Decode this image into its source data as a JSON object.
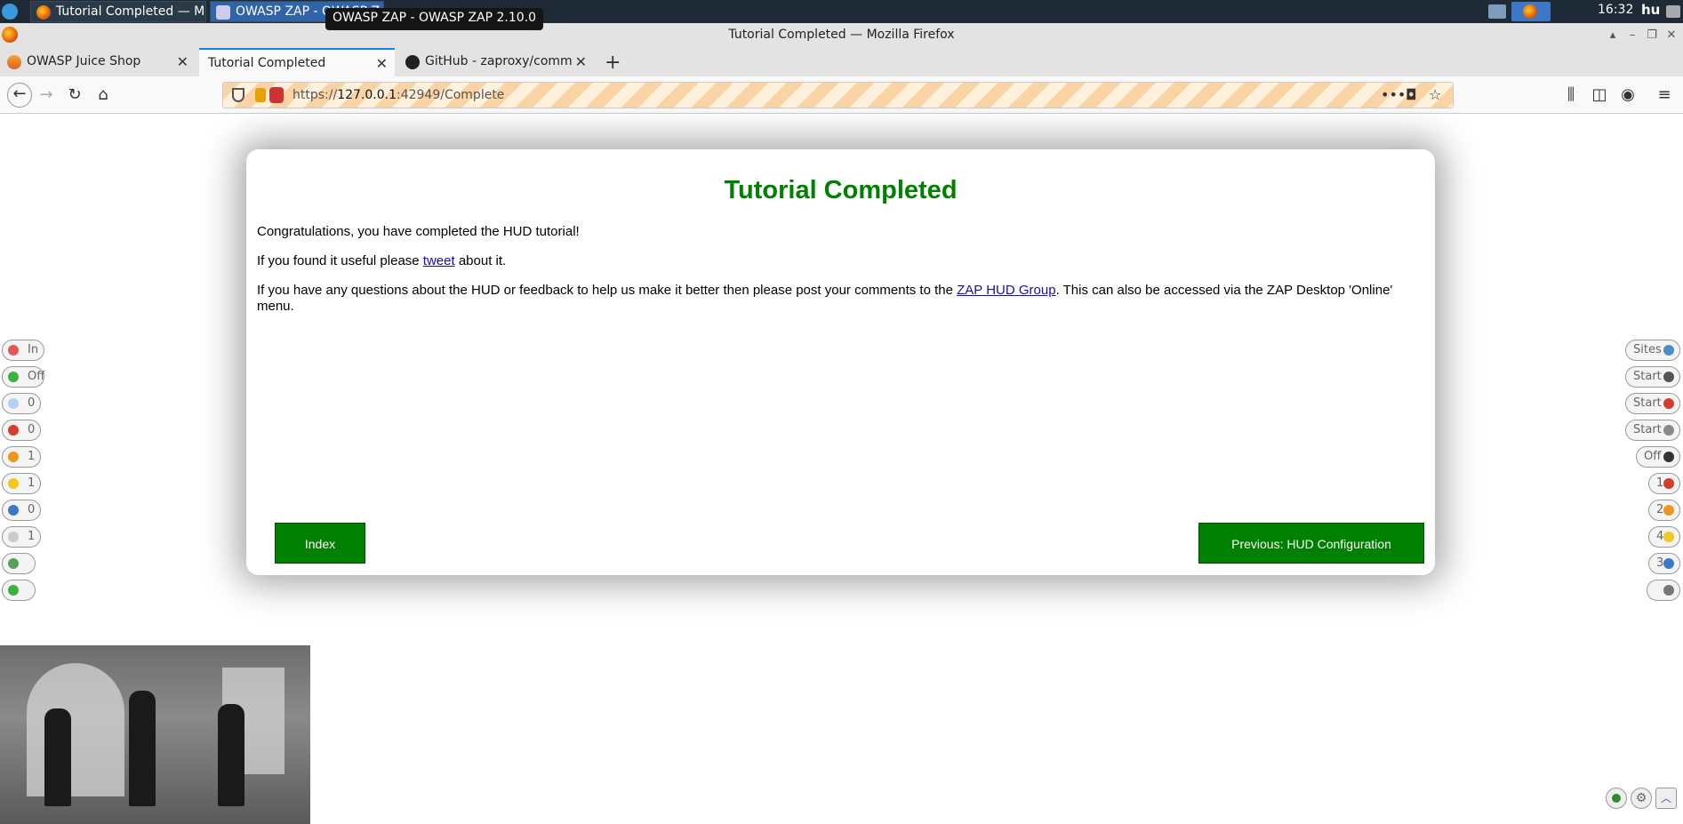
{
  "taskbar": {
    "tasks": [
      "Tutorial Completed — M...",
      "OWASP ZAP - OWASP Z..."
    ],
    "tooltip": "OWASP ZAP - OWASP ZAP 2.10.0",
    "clock": "16:32",
    "user": "hu"
  },
  "window": {
    "title": "Tutorial Completed — Mozilla Firefox"
  },
  "tabs": [
    {
      "label": "OWASP Juice Shop"
    },
    {
      "label": "Tutorial Completed"
    },
    {
      "label": "GitHub - zaproxy/comm"
    }
  ],
  "url": {
    "prefix": "https://",
    "host": "127.0.0.1",
    "rest": ":42949/Complete"
  },
  "dialog": {
    "title": "Tutorial Completed",
    "p1": "Congratulations, you have completed the HUD tutorial!",
    "p2_before": "If you found it useful please ",
    "p2_link": "tweet",
    "p2_after": " about it.",
    "p3_before": "If you have any questions about the HUD or feedback to help us make it better then please post your comments to the ",
    "p3_link": "ZAP HUD Group",
    "p3_after": ". This can also be accessed via the ZAP Desktop 'Online' menu.",
    "index_button": "Index",
    "prev_button": "Previous: HUD Configuration"
  },
  "hud_left": [
    {
      "label": "In",
      "icon": "target-icon",
      "color": "#e05a5a"
    },
    {
      "label": "Off",
      "icon": "green-dot-icon",
      "color": "#3cb043"
    },
    {
      "label": "0",
      "icon": "lightbulb-icon",
      "color": "#b8d0f0"
    },
    {
      "label": "0",
      "icon": "red-flag-icon",
      "color": "#d43c2c"
    },
    {
      "label": "1",
      "icon": "orange-flag-icon",
      "color": "#f0961e"
    },
    {
      "label": "1",
      "icon": "yellow-flag-icon",
      "color": "#f0c81e"
    },
    {
      "label": "0",
      "icon": "blue-flag-icon",
      "color": "#3c78c8"
    },
    {
      "label": "1",
      "icon": "comment-icon",
      "color": "#cccccc"
    },
    {
      "label": "",
      "icon": "page-add-icon",
      "color": "#5aa05a"
    },
    {
      "label": "",
      "icon": "plus-icon",
      "color": "#3cb043"
    }
  ],
  "hud_right": [
    {
      "label": "Sites",
      "icon": "globe-icon",
      "color": "#4a8ec8"
    },
    {
      "label": "Start",
      "icon": "spider-icon",
      "color": "#555555"
    },
    {
      "label": "Start",
      "icon": "ajax-spider-icon",
      "color": "#d43c2c"
    },
    {
      "label": "Start",
      "icon": "flame-icon",
      "color": "#888888"
    },
    {
      "label": "Off",
      "icon": "crosshair-icon",
      "color": "#333333"
    },
    {
      "label": "1",
      "icon": "red-flag-icon",
      "color": "#d43c2c"
    },
    {
      "label": "2",
      "icon": "orange-flag-icon",
      "color": "#f0961e"
    },
    {
      "label": "4",
      "icon": "yellow-flag-icon",
      "color": "#f0c81e"
    },
    {
      "label": "3",
      "icon": "blue-flag-icon",
      "color": "#3c78c8"
    },
    {
      "label": "",
      "icon": "panel-icon",
      "color": "#777777"
    }
  ]
}
